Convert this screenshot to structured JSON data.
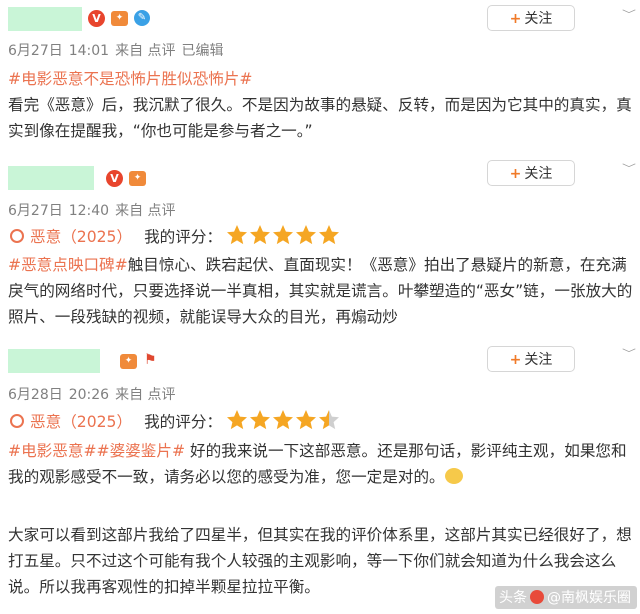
{
  "colors": {
    "accent": "#eb7350",
    "star": "#f5a623",
    "follow_plus": "#f07a28"
  },
  "follow_label": "关注",
  "posts": [
    {
      "meta": {
        "date": "6月27日",
        "time": "14:01",
        "source": "来自 点评",
        "edited": "已编辑"
      },
      "hashtag": "#电影恶意不是恐怖片胜似恐怖片#",
      "text": "看完《恶意》后，我沉默了很久。不是因为故事的悬疑、反转，而是因为它其中的真实，真实到像在提醒我，“你也可能是参与者之一。”"
    },
    {
      "meta": {
        "date": "6月27日",
        "time": "12:40",
        "source": "来自 点评"
      },
      "film_title": "恶意（2025）",
      "rating_label": "我的评分：",
      "rating_stars": 5,
      "hashtag": "#恶意点映口碑#",
      "text": "触目惊心、跌宕起伏、直面现实！《恶意》拍出了悬疑片的新意，在充满戾气的网络时代，只要选择说一半真相，其实就是谎言。叶攀塑造的“恶女”链，一张放大的照片、一段残缺的视频，就能误导大众的目光，再煽动炒"
    },
    {
      "meta": {
        "date": "6月28日",
        "time": "20:26",
        "source": "来自 点评"
      },
      "film_title": "恶意（2025）",
      "rating_label": "我的评分：",
      "rating_stars": 4.5,
      "hashtag": "#电影恶意##婆婆鉴片#",
      "text": " 好的我来说一下这部恶意。还是那句话，影评纯主观，如果您和我的观影感受不一致，请务必以您的感受为准，您一定是对的。",
      "text2": "大家可以看到这部片我给了四星半，但其实在我的评价体系里，这部片其实已经很好了，想打五星。只不过这个可能有我个人较强的主观影响，等一下你们就会知道为什么我会这么说。所以我再客观性的扣掉半颗星拉拉平衡。"
    }
  ],
  "watermark": {
    "prefix": "头条",
    "handle": "@南枫娱乐圈"
  }
}
